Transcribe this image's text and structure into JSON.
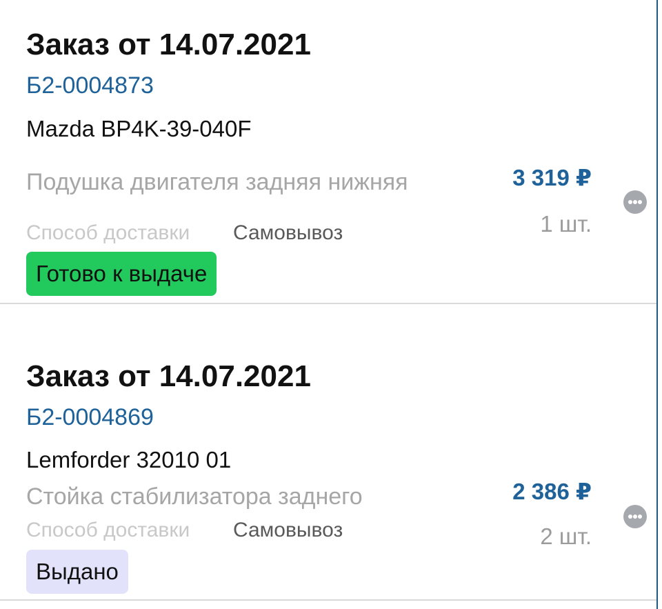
{
  "orders": [
    {
      "title": "Заказ от 14.07.2021",
      "number": "Б2-0004873",
      "article": "Mazda BP4K-39-040F",
      "product": "Подушка двигателя задняя нижняя",
      "price": "3 319 ₽",
      "quantity": "1 шт.",
      "delivery_label": "Способ доставки",
      "delivery_value": "Самовывоз",
      "status": "Готово к выдаче",
      "status_color": "#22c95c"
    },
    {
      "title": "Заказ от 14.07.2021",
      "number": "Б2-0004869",
      "article": "Lemforder 32010 01",
      "product": "Стойка стабилизатора заднего",
      "price": "2 386 ₽",
      "quantity": "2 шт.",
      "delivery_label": "Способ доставки",
      "delivery_value": "Самовывоз",
      "status": "Выдано",
      "status_color": "#e2e3fb"
    }
  ],
  "icons": {
    "more": "more-options-icon"
  },
  "colors": {
    "accent": "#1e6299",
    "divider": "#d9d9d9",
    "muted": "#a6a6a6"
  }
}
